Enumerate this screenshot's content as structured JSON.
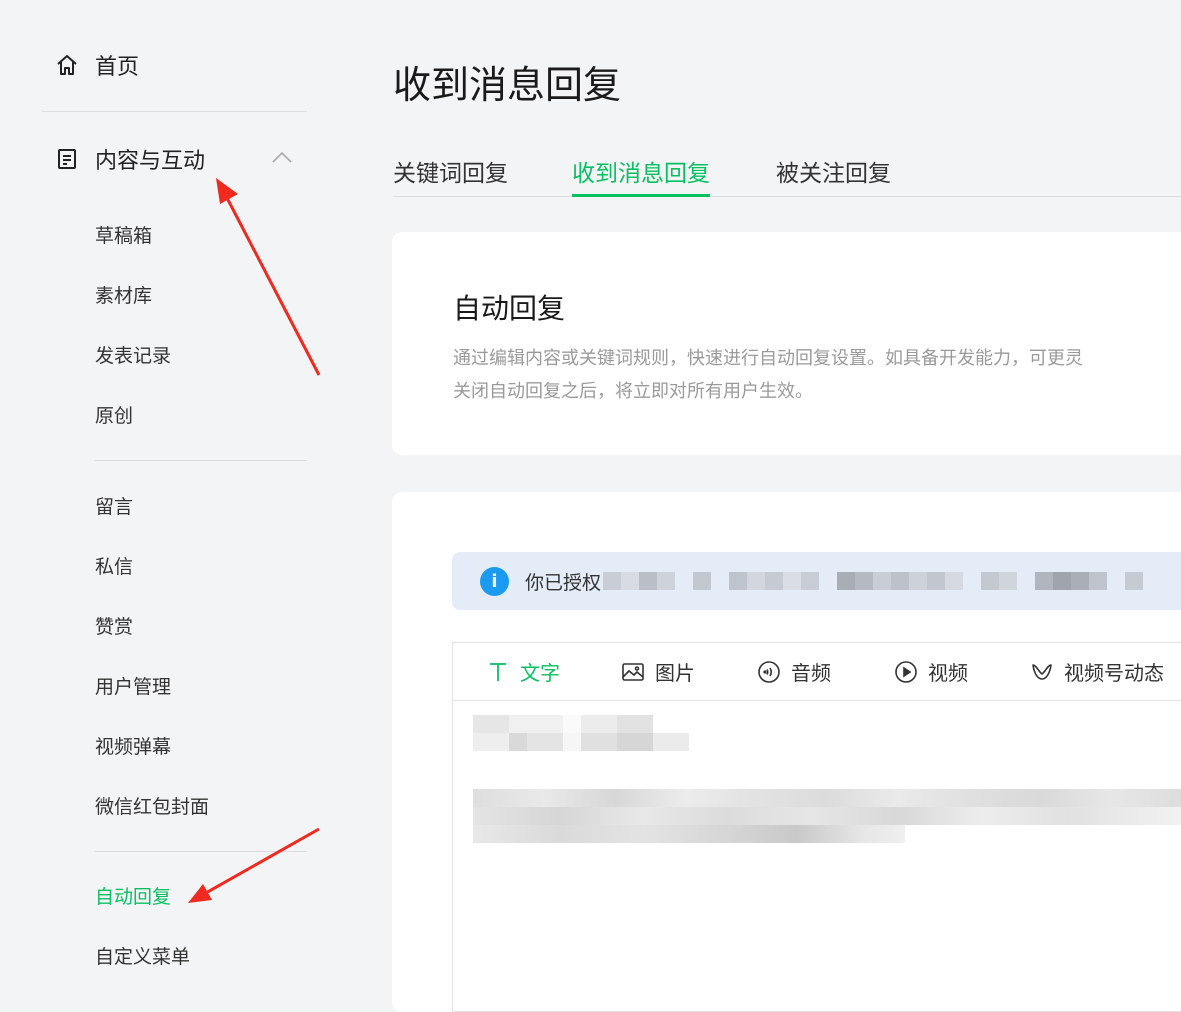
{
  "sidebar": {
    "home": "首页",
    "group": "内容与互动",
    "items_a": [
      "草稿箱",
      "素材库",
      "发表记录",
      "原创"
    ],
    "items_b": [
      "留言",
      "私信",
      "赞赏",
      "用户管理",
      "视频弹幕",
      "微信红包封面",
      "自动回复",
      "自定义菜单"
    ],
    "active_item": "自动回复"
  },
  "main": {
    "title": "收到消息回复",
    "tabs": [
      "关键词回复",
      "收到消息回复",
      "被关注回复"
    ],
    "active_tab": "收到消息回复"
  },
  "auto_reply": {
    "title": "自动回复",
    "desc_line1": "通过编辑内容或关键词规则，快速进行自动回复设置。如具备开发能力，可更灵",
    "desc_line2": "关闭自动回复之后，将立即对所有用户生效。"
  },
  "notice": {
    "icon": "info-icon",
    "text": "你已授权"
  },
  "editor": {
    "tabs": [
      {
        "label": "文字",
        "icon": "text-icon"
      },
      {
        "label": "图片",
        "icon": "image-icon"
      },
      {
        "label": "音频",
        "icon": "audio-icon"
      },
      {
        "label": "视频",
        "icon": "video-icon"
      },
      {
        "label": "视频号动态",
        "icon": "channels-icon"
      }
    ],
    "active_tab": "文字"
  },
  "colors": {
    "accent": "#07c160",
    "info": "#1a9bf0",
    "arrow": "#f02a1f"
  }
}
